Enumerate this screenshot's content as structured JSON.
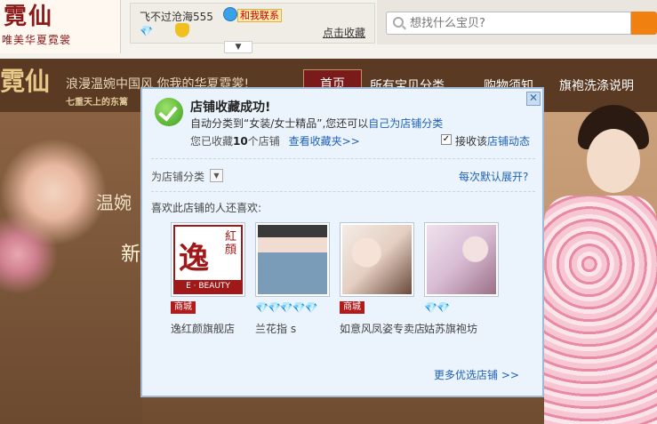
{
  "header": {
    "logo_text": "霓仙",
    "logo_tagline": "唯美华夏霓裳",
    "seller_name": "飞不过沧海555",
    "contact_label": "和我联系",
    "favorite_link": "点击收藏",
    "search_placeholder": "想找什么宝贝?",
    "diamond_glyph": "💎"
  },
  "banner": {
    "logo": "霓仙",
    "slogan": "浪漫温婉中国风  你我的华夏霓裳!",
    "subtitle": "七重天上的东篱",
    "nav": [
      "首页",
      "所有宝贝分类",
      "购物须知",
      "旗袍洗涤说明"
    ]
  },
  "hero": {
    "text1": "温婉",
    "text2": "新"
  },
  "popup": {
    "title": "店铺收藏成功!",
    "line1_prefix": "自动分类到“女装/女士精品”,您还可以",
    "line1_link": "自己为店铺分类",
    "line2_prefix": "您已收藏",
    "line2_count": "10",
    "line2_suffix": "个店铺",
    "view_favorites": "查看收藏夹>>",
    "receive_label_prefix": "接收该",
    "receive_label_link": "店铺动态",
    "receive_checked": "✓",
    "category_label": "为店铺分类",
    "expand_default": "每次默认展开?",
    "also_like_label": "喜欢此店铺的人还喜欢:",
    "shops": [
      {
        "name": "逸红颜旗舰店",
        "badge_type": "mall",
        "badge": "商城",
        "thumb_text": "逸",
        "thumb_sub": "E · BEAUTY",
        "thumb_side": "紅顔"
      },
      {
        "name": "兰花指 s",
        "badge_type": "diamonds",
        "badge": "💎💎💎💎💎"
      },
      {
        "name": "如意风凤姿专卖店",
        "badge_type": "mall",
        "badge": "商城"
      },
      {
        "name": "姑苏旗袍坊",
        "badge_type": "diamonds",
        "badge": "💎💎"
      }
    ],
    "more_shops": "更多优选店铺 >>",
    "close_glyph": "✕"
  }
}
